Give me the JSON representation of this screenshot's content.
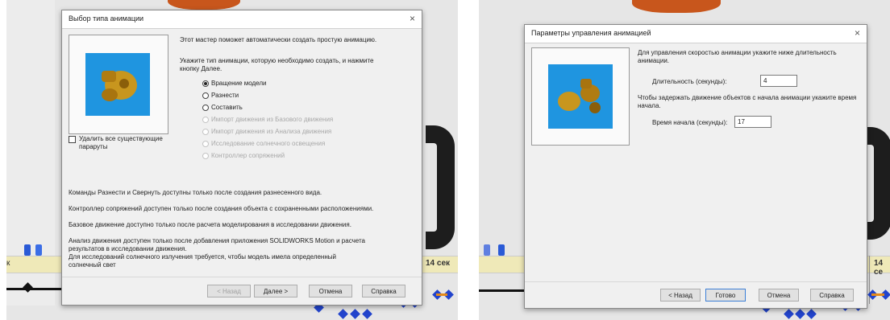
{
  "left_dialog": {
    "title": "Выбор типа анимации",
    "close": "×",
    "intro": "Этот мастер поможет автоматически создать простую анимацию.",
    "prompt_line1": "Укажите тип анимации, которую необходимо создать, и нажмите",
    "prompt_line2": "кнопку Далее.",
    "options": [
      {
        "label": "Вращение модели",
        "selected": true,
        "enabled": true
      },
      {
        "label": "Разнести",
        "selected": false,
        "enabled": true
      },
      {
        "label": "Составить",
        "selected": false,
        "enabled": true
      },
      {
        "label": "Импорт движения из Базового движения",
        "selected": false,
        "enabled": false
      },
      {
        "label": "Импорт движения из Анализа движения",
        "selected": false,
        "enabled": false
      },
      {
        "label": "Исследование солнечного освещения",
        "selected": false,
        "enabled": false
      },
      {
        "label": "Контроллер сопряжений",
        "selected": false,
        "enabled": false
      }
    ],
    "checkbox_line1": "Удалить все существующие",
    "checkbox_line2": "параруты",
    "note1": "Команды Разнести и Свернуть доступны только после создания разнесенного вида.",
    "note2": "Контроллер сопряжений доступен только после создания объекта с сохраненными расположениями.",
    "note3": "Базовое движение доступно только после расчета моделирования в исследовании движения.",
    "note4_line1": "Анализ движения доступен только после добавления приложения SOLIDWORKS Motion и расчета",
    "note4_line2": "результатов в исследовании движения.",
    "note4_line3": "Для исследований солнечного излучения требуется, чтобы модель имела определенный",
    "note4_line4": "солнечный свет",
    "buttons": {
      "back": "< Назад",
      "next": "Далее >",
      "cancel": "Отмена",
      "help": "Справка"
    }
  },
  "right_dialog": {
    "title": "Параметры управления анимацией",
    "close": "×",
    "desc1_line1": "Для управления скоростью анимации укажите ниже длительность",
    "desc1_line2": "анимации.",
    "duration_label": "Длительность (секунды):",
    "duration_value": "4",
    "desc2_line1": "Чтобы задержать движение объектов с начала анимации укажите время",
    "desc2_line2": "начала.",
    "start_label": "Время начала (секунды):",
    "start_value": "17",
    "buttons": {
      "back": "< Назад",
      "finish": "Готово",
      "cancel": "Отмена",
      "help": "Справка"
    }
  },
  "timeline": {
    "left_time": "14 сек",
    "right_time": "14 се",
    "left_stub": "к"
  },
  "colors": {
    "accent_blue": "#1f95e0",
    "model_gold": "#c8961e",
    "timeline_bar": "#efe9b8"
  }
}
